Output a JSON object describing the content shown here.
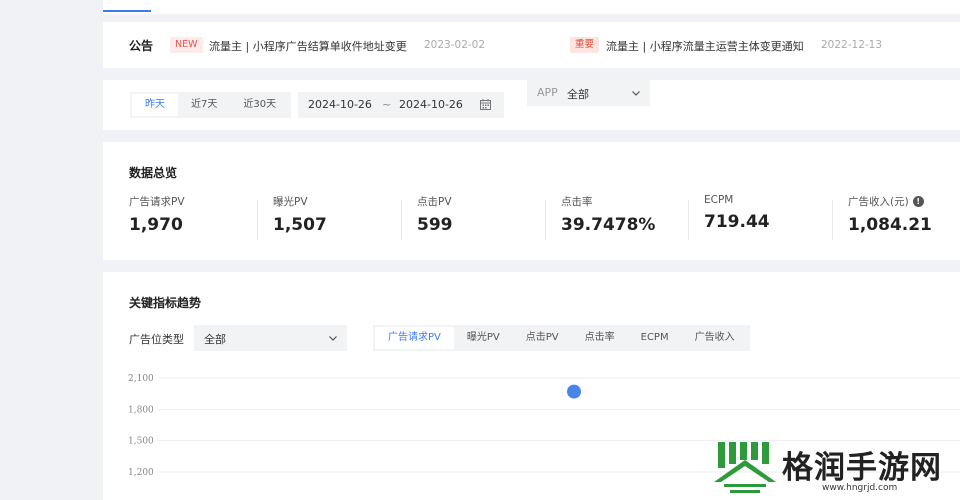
{
  "notice": {
    "label": "公告",
    "items": [
      {
        "badge": "NEW",
        "text": "流量主 | 小程序广告结算单收件地址变更",
        "date": "2023-02-02"
      },
      {
        "badge": "重要",
        "text": "流量主 | 小程序流量主运营主体变更通知",
        "date": "2022-12-13"
      }
    ]
  },
  "filters": {
    "range_tabs": [
      "昨天",
      "近7天",
      "近30天"
    ],
    "active_range": "昨天",
    "date_start": "2024-10-26",
    "date_sep": "~",
    "date_end": "2024-10-26",
    "app_label": "APP",
    "app_value": "全部"
  },
  "overview": {
    "title": "数据总览",
    "metrics": [
      {
        "label": "广告请求PV",
        "value": "1,970"
      },
      {
        "label": "曝光PV",
        "value": "1,507"
      },
      {
        "label": "点击PV",
        "value": "599"
      },
      {
        "label": "点击率",
        "value": "39.7478%"
      },
      {
        "label": "ECPM",
        "value": "719.44"
      },
      {
        "label": "广告收入(元)",
        "value": "1,084.21",
        "info": "!"
      }
    ]
  },
  "trend": {
    "title": "关键指标趋势",
    "slot_type_label": "广告位类型",
    "slot_type_value": "全部",
    "metric_tabs": [
      "广告请求PV",
      "曝光PV",
      "点击PV",
      "点击率",
      "ECPM",
      "广告收入"
    ],
    "active_metric": "广告请求PV"
  },
  "chart_data": {
    "type": "scatter",
    "y_ticks": [
      "2,100",
      "1,800",
      "1,500",
      "1,200"
    ],
    "y_tick_values": [
      2100,
      1800,
      1500,
      1200
    ],
    "ylim": [
      1200,
      2100
    ],
    "x_visible_range": [
      0,
      1
    ],
    "points": [
      {
        "x": 0.5,
        "y": 1970
      }
    ],
    "grid": true,
    "point_color": "#4a86e8"
  },
  "watermark": {
    "text": "格润手游网",
    "url": "www.hngrjd.com",
    "color": "#2e9a3c"
  }
}
